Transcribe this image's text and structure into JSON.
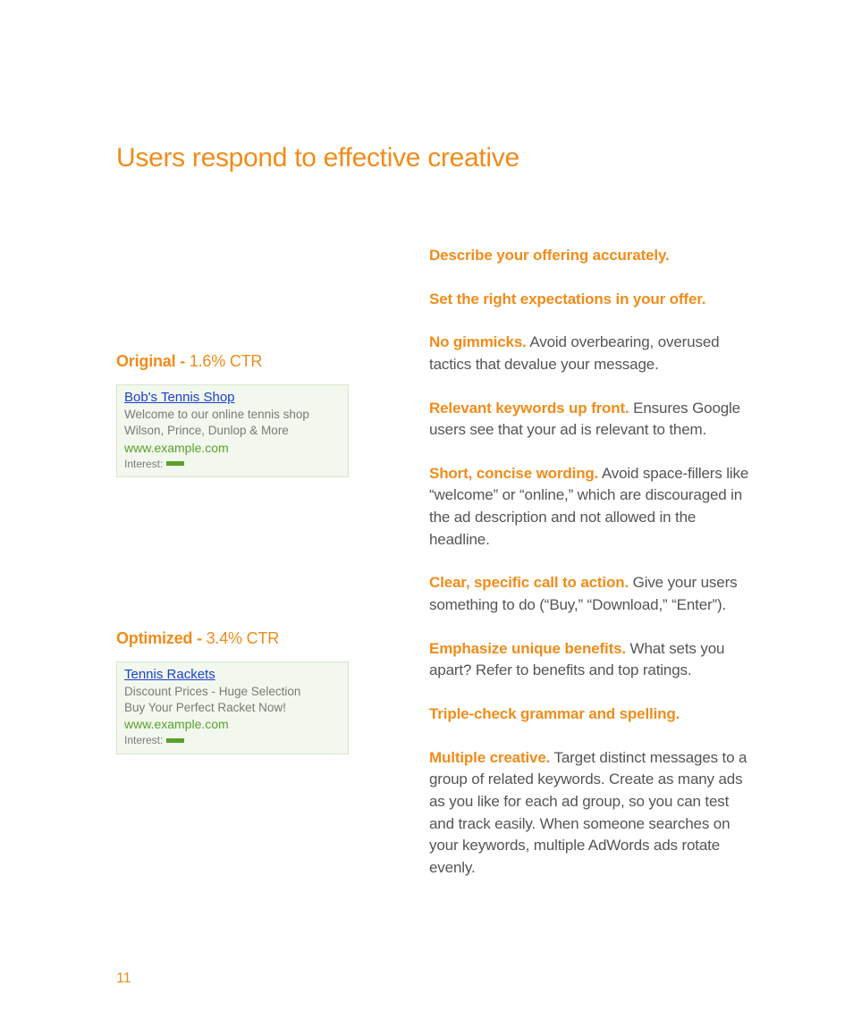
{
  "title": "Users respond to effective creative",
  "pageNumber": "11",
  "left": {
    "original": {
      "labelBold": "Original - ",
      "labelVal": "1.6% CTR",
      "ad": {
        "title": "Bob's Tennis Shop",
        "line1": "Welcome to our online tennis shop",
        "line2": "Wilson, Prince, Dunlop & More",
        "url": "www.example.com",
        "interest": "Interest:",
        "barPct": 45
      }
    },
    "optimized": {
      "labelBold": "Optimized - ",
      "labelVal": "3.4% CTR",
      "ad": {
        "title": "Tennis Rackets",
        "line1": "Discount Prices - Huge Selection",
        "line2": "Buy Your Perfect Racket Now!",
        "url": "www.example.com",
        "interest": "Interest:",
        "barPct": 45
      }
    }
  },
  "tips": [
    {
      "lead": "Describe your offering accurately.",
      "body": ""
    },
    {
      "lead": "Set the right expectations in your offer.",
      "body": ""
    },
    {
      "lead": "No gimmicks.",
      "body": " Avoid overbearing, overused tactics that devalue your message."
    },
    {
      "lead": "Relevant keywords up front.",
      "body": " Ensures Google users see that your ad is relevant to them."
    },
    {
      "lead": "Short, concise wording.",
      "body": " Avoid space-fillers like “welcome” or “online,” which are discouraged in the ad description and not allowed in the headline."
    },
    {
      "lead": "Clear, specific call to action.",
      "body": " Give your users something to do (“Buy,” “Download,” “Enter”)."
    },
    {
      "lead": "Emphasize unique benefits.",
      "body": " What sets you apart? Refer to benefits and top ratings."
    },
    {
      "lead": "Triple-check grammar and spelling.",
      "body": ""
    },
    {
      "lead": "Multiple creative.",
      "body": " Target distinct messages to a group of related keywords. Create as many ads as you like for each ad group, so you can test and track easily. When someone searches on your keywords, multiple AdWords ads rotate evenly."
    }
  ]
}
